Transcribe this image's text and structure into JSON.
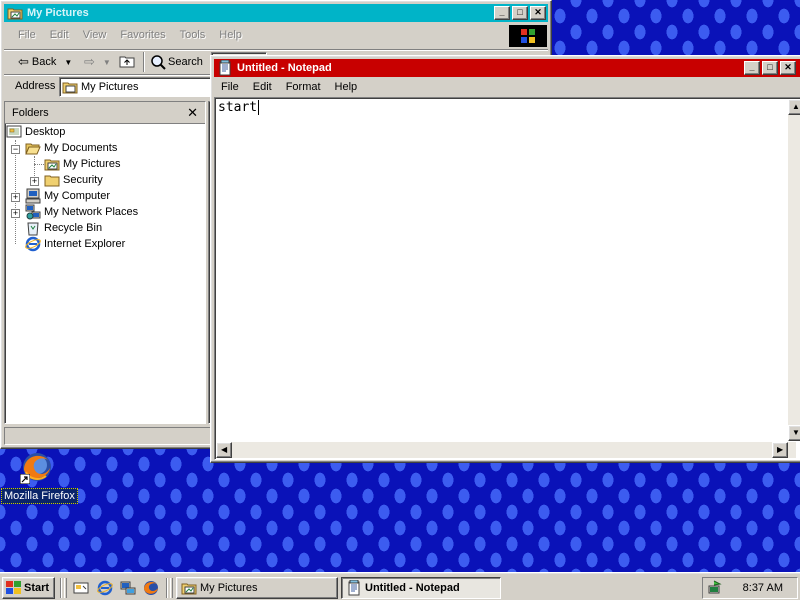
{
  "explorer": {
    "title": "My Pictures",
    "menu": [
      "File",
      "Edit",
      "View",
      "Favorites",
      "Tools",
      "Help"
    ],
    "toolbar": {
      "back_label": "Back",
      "search_label": "Search"
    },
    "address_label": "Address",
    "address_value": "My Pictures",
    "folders_label": "Folders",
    "tree": [
      "Desktop",
      "My Documents",
      "My Pictures",
      "Security",
      "My Computer",
      "My Network Places",
      "Recycle Bin",
      "Internet Explorer"
    ]
  },
  "notepad": {
    "title": "Untitled - Notepad",
    "menu": [
      "File",
      "Edit",
      "Format",
      "Help"
    ],
    "content": "start"
  },
  "desktop": {
    "icon_label": "Mozilla Firefox"
  },
  "taskbar": {
    "start_label": "Start",
    "tasks": [
      "My Pictures",
      "Untitled - Notepad"
    ],
    "clock": "8:37 AM"
  },
  "colors": {
    "active_title": "#c80000",
    "inactive_title": "#00b4c8",
    "face": "#d4d0c8",
    "desktop": "#0a12b8"
  },
  "icons": {
    "folder": "folder-icon",
    "computer": "computer-icon",
    "network": "network-icon",
    "recycle": "recycle-bin-icon",
    "ie": "internet-explorer-icon",
    "firefox": "firefox-icon",
    "notepad": "notepad-icon"
  }
}
